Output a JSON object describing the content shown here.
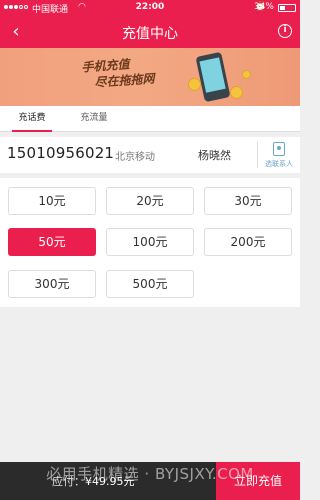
{
  "status_bar": {
    "carrier": "中国联通",
    "time": "22:00",
    "battery": "34%",
    "battery_level": 0.34
  },
  "navbar": {
    "title": "充值中心"
  },
  "banner": {
    "line1": "手机充值",
    "line2": "尽在拖拖网"
  },
  "tabs": [
    {
      "label": "充话费",
      "active": true
    },
    {
      "label": "充流量",
      "active": false
    }
  ],
  "phone": {
    "number": "15010956021",
    "operator": "北京移动",
    "name": "杨晓然",
    "contacts_label": "选联系人"
  },
  "amounts": [
    {
      "label": "10元",
      "selected": false
    },
    {
      "label": "20元",
      "selected": false
    },
    {
      "label": "30元",
      "selected": false
    },
    {
      "label": "50元",
      "selected": true
    },
    {
      "label": "100元",
      "selected": false
    },
    {
      "label": "200元",
      "selected": false
    },
    {
      "label": "300元",
      "selected": false
    },
    {
      "label": "500元",
      "selected": false
    }
  ],
  "bottom": {
    "price_label": "应付：",
    "price_value": "¥49.95元",
    "pay_button": "立即充值"
  },
  "watermark": "必用手机精选 · BYJSJXY.COM",
  "colors": {
    "accent": "#ea1f4d",
    "bottom_bar": "#2b2b2b"
  }
}
